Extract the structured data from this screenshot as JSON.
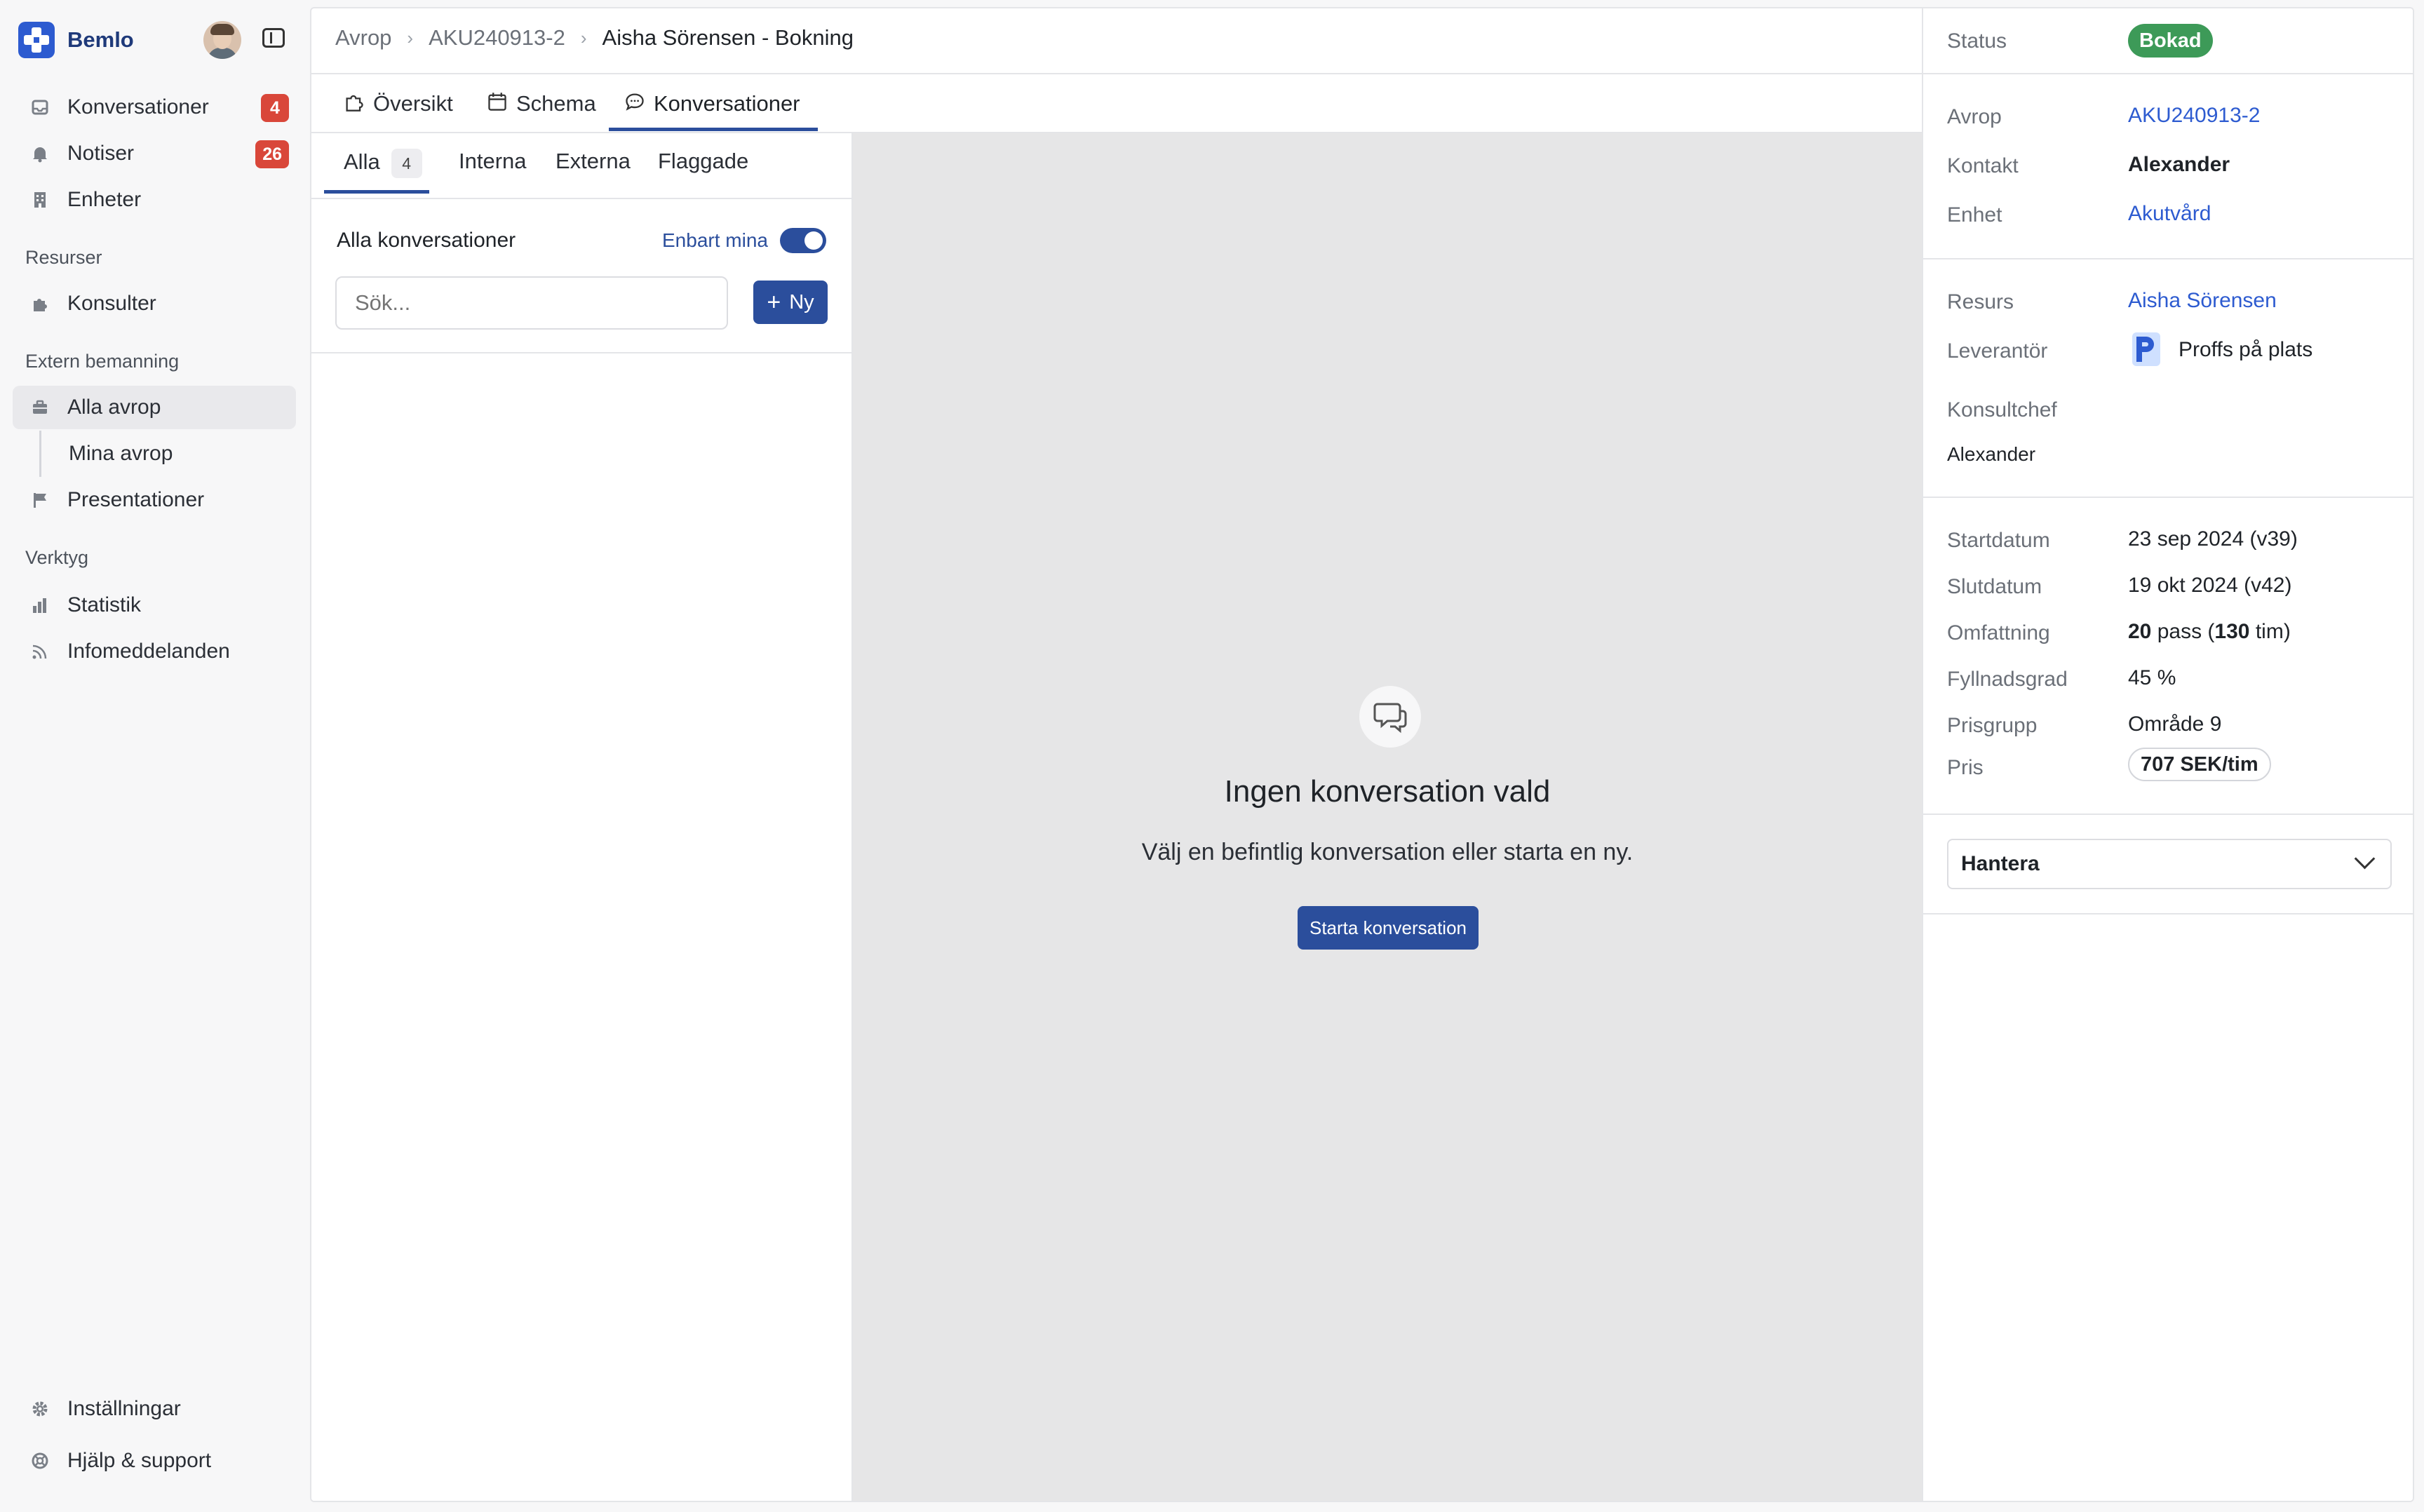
{
  "brand": {
    "name": "Bemlo"
  },
  "sidebar": {
    "top_items": [
      {
        "label": "Konversationer",
        "badge": "4"
      },
      {
        "label": "Notiser",
        "badge": "26"
      },
      {
        "label": "Enheter"
      }
    ],
    "sections": [
      {
        "label": "Resurser"
      },
      {
        "label": "Extern bemanning"
      },
      {
        "label": "Verktyg"
      }
    ],
    "resources": [
      {
        "label": "Konsulter"
      }
    ],
    "staffing": [
      {
        "label": "Alla avrop"
      },
      {
        "label": "Mina avrop"
      },
      {
        "label": "Presentationer"
      }
    ],
    "tools": [
      {
        "label": "Statistik"
      },
      {
        "label": "Infomeddelanden"
      }
    ],
    "bottom": [
      {
        "label": "Inställningar"
      },
      {
        "label": "Hjälp & support"
      }
    ]
  },
  "breadcrumb": {
    "items": [
      "Avrop",
      "AKU240913-2",
      "Aisha Sörensen - Bokning"
    ]
  },
  "tabs": [
    {
      "label": "Översikt",
      "icon": "puzzle-icon"
    },
    {
      "label": "Schema",
      "icon": "calendar-icon"
    },
    {
      "label": "Konversationer",
      "icon": "chat-bubble-icon"
    }
  ],
  "conversations": {
    "filters": [
      {
        "label": "Alla",
        "count": "4"
      },
      {
        "label": "Interna"
      },
      {
        "label": "Externa"
      },
      {
        "label": "Flaggade"
      }
    ],
    "title": "Alla konversationer",
    "only_mine_label": "Enbart mina",
    "only_mine_on": true,
    "search_placeholder": "Sök...",
    "new_button": "Ny"
  },
  "empty_state": {
    "title": "Ingen konversation vald",
    "text": "Välj en befintlig konversation eller starta en ny.",
    "button": "Starta konversation"
  },
  "details": {
    "status": {
      "label": "Status",
      "value": "Bokad",
      "color": "#3d9a58"
    },
    "avrop": {
      "label": "Avrop",
      "value": "AKU240913-2"
    },
    "kontakt": {
      "label": "Kontakt",
      "value": "Alexander"
    },
    "enhet": {
      "label": "Enhet",
      "value": "Akutvård"
    },
    "resurs": {
      "label": "Resurs",
      "value": "Aisha Sörensen"
    },
    "leverantor": {
      "label": "Leverantör",
      "value": "Proffs på plats"
    },
    "konsultchef": {
      "label": "Konsultchef",
      "value": "Alexander"
    },
    "startdatum": {
      "label": "Startdatum",
      "value": "23 sep 2024 (v39)"
    },
    "slutdatum": {
      "label": "Slutdatum",
      "value": "19 okt 2024 (v42)"
    },
    "omfattning": {
      "label": "Omfattning",
      "pass": "20",
      "pass_unit": "pass",
      "hours": "130",
      "hours_unit": "tim"
    },
    "fyllnadsgrad": {
      "label": "Fyllnadsgrad",
      "value": "45 %"
    },
    "prisgrupp": {
      "label": "Prisgrupp",
      "value": "Område 9"
    },
    "pris": {
      "label": "Pris",
      "value": "707 SEK/tim"
    },
    "manage": {
      "label": "Hantera"
    }
  },
  "colors": {
    "accent": "#2b4e9c",
    "link": "#2d5bd0",
    "badge": "#d9473a",
    "success": "#3d9a58"
  }
}
